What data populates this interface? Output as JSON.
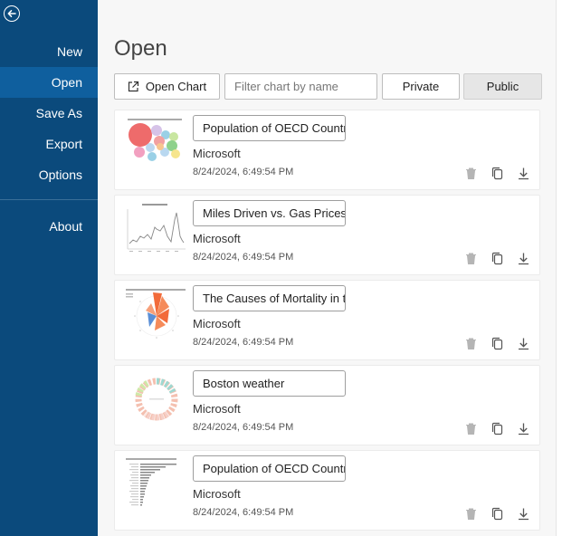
{
  "sidebar": {
    "back_icon": "back-arrow-icon",
    "items": [
      {
        "label": "New",
        "active": false
      },
      {
        "label": "Open",
        "active": true
      },
      {
        "label": "Save As",
        "active": false
      },
      {
        "label": "Export",
        "active": false
      },
      {
        "label": "Options",
        "active": false
      },
      {
        "label": "About",
        "active": false
      }
    ]
  },
  "main": {
    "title": "Open",
    "toolbar": {
      "open_chart_label": "Open Chart",
      "open_chart_icon": "open-external-icon",
      "filter_placeholder": "Filter chart by name",
      "filter_value": "",
      "tab_private": "Private",
      "tab_public": "Public",
      "selected_tab": "Public"
    },
    "charts": [
      {
        "name": "Population of OECD Countries",
        "owner": "Microsoft",
        "date": "8/24/2024, 6:49:54 PM",
        "thumb": "bubble-chart"
      },
      {
        "name": "Miles Driven vs. Gas Prices",
        "owner": "Microsoft",
        "date": "8/24/2024, 6:49:54 PM",
        "thumb": "line-chart"
      },
      {
        "name": "The Causes of Mortality in the Army",
        "owner": "Microsoft",
        "date": "8/24/2024, 6:49:54 PM",
        "thumb": "rose-chart"
      },
      {
        "name": "Boston weather",
        "owner": "Microsoft",
        "date": "8/24/2024, 6:49:54 PM",
        "thumb": "radial-chart"
      },
      {
        "name": "Population of OECD Countries",
        "owner": "Microsoft",
        "date": "8/24/2024, 6:49:54 PM",
        "thumb": "bar-chart"
      }
    ],
    "action_icons": [
      "trash-icon",
      "copy-icon",
      "download-icon"
    ],
    "colors": {
      "sidebar": "#0b4a7c",
      "sidebar_active": "#0f5f9e",
      "action_icon": "#888888",
      "trash_icon": "#b5b5b5"
    }
  }
}
